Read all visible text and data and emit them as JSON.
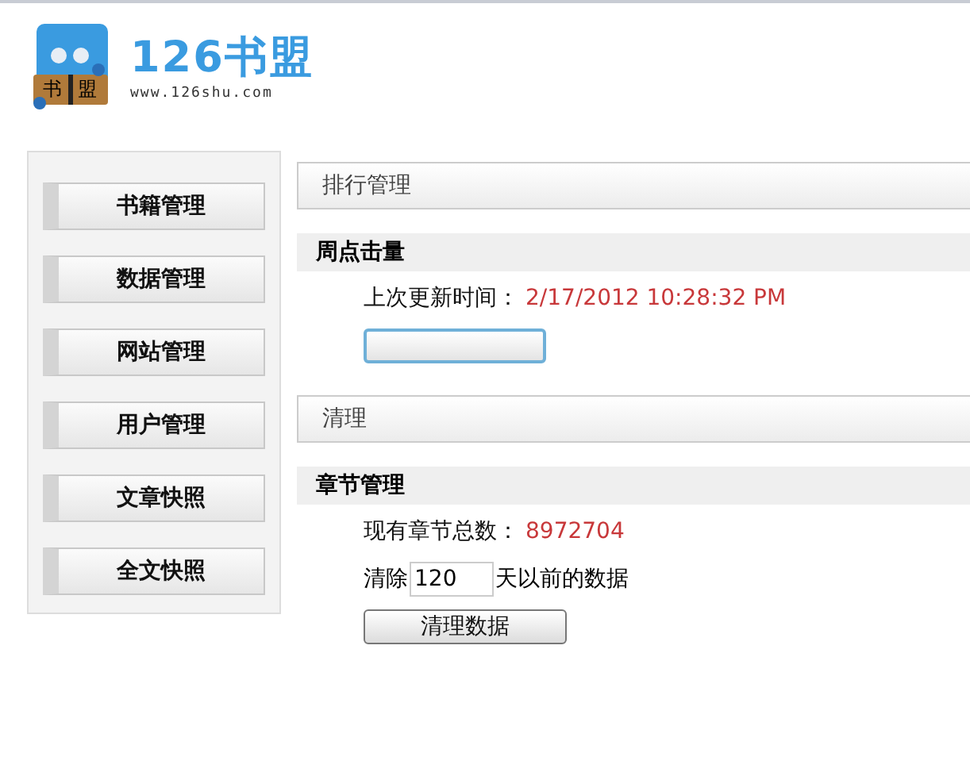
{
  "logo": {
    "title": "126书盟",
    "url": "www.126shu.com",
    "badge_left": "书",
    "badge_right": "盟"
  },
  "sidebar": {
    "items": [
      {
        "label": "书籍管理"
      },
      {
        "label": "数据管理"
      },
      {
        "label": "网站管理"
      },
      {
        "label": "用户管理"
      },
      {
        "label": "文章快照"
      },
      {
        "label": "全文快照"
      }
    ]
  },
  "sections": [
    {
      "title": "排行管理",
      "groups": [
        {
          "heading": "周点击量",
          "rows": [
            {
              "kind": "info",
              "label": "上次更新时间：",
              "value": "2/17/2012 10:28:32 PM"
            },
            {
              "kind": "focused_button"
            }
          ]
        }
      ]
    },
    {
      "title": "清理",
      "groups": [
        {
          "heading": "章节管理",
          "rows": [
            {
              "kind": "info",
              "label": "现有章节总数：",
              "value": "8972704"
            },
            {
              "kind": "input",
              "before": "清除",
              "value": "120",
              "after": "天以前的数据"
            },
            {
              "kind": "button",
              "label": "清理数据"
            }
          ]
        }
      ]
    }
  ]
}
